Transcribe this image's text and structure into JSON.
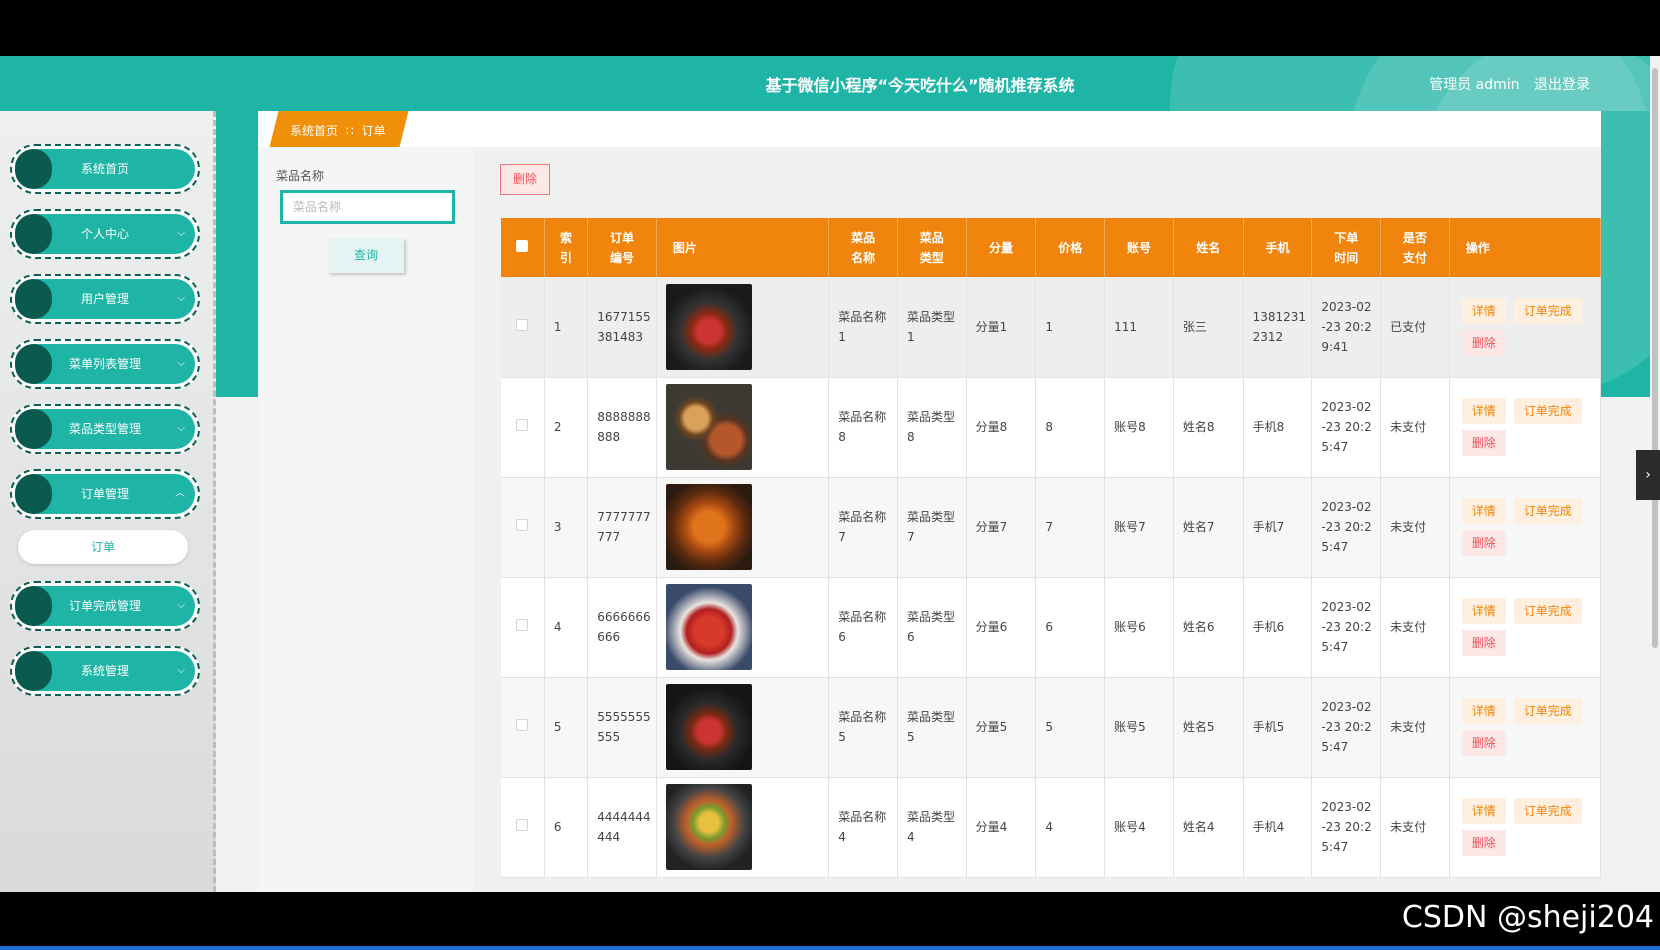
{
  "header": {
    "title": "基于微信小程序“今天吃什么”随机推荐系统",
    "user_label": "管理员 admin",
    "logout": "退出登录"
  },
  "sidebar": {
    "items": [
      {
        "label": "系统首页",
        "chevron": ""
      },
      {
        "label": "个人中心",
        "chevron": "⌵"
      },
      {
        "label": "用户管理",
        "chevron": "⌵"
      },
      {
        "label": "菜单列表管理",
        "chevron": "⌵"
      },
      {
        "label": "菜品类型管理",
        "chevron": "⌵"
      },
      {
        "label": "订单管理",
        "chevron": "︿"
      },
      {
        "label": "订单完成管理",
        "chevron": "⌵"
      },
      {
        "label": "系统管理",
        "chevron": "⌵"
      }
    ],
    "sub_item": "订单"
  },
  "breadcrumb": {
    "home": "系统首页",
    "sep": "∷",
    "current": "订单"
  },
  "filter": {
    "label": "菜品名称",
    "placeholder": "菜品名称",
    "query": "查询"
  },
  "toolbar": {
    "delete": "删除"
  },
  "table": {
    "headers": [
      "索引",
      "订单编号",
      "图片",
      "菜品名称",
      "菜品类型",
      "分量",
      "价格",
      "账号",
      "姓名",
      "手机",
      "下单时间",
      "是否支付",
      "操作"
    ],
    "headers_lines": [
      [
        "索",
        "引"
      ],
      [
        "订单",
        "编号"
      ],
      [
        "图片"
      ],
      [
        "菜品",
        "名称"
      ],
      [
        "菜品",
        "类型"
      ],
      [
        "分量"
      ],
      [
        "价格"
      ],
      [
        "账号"
      ],
      [
        "姓名"
      ],
      [
        "手机"
      ],
      [
        "下单",
        "时间"
      ],
      [
        "是否",
        "支付"
      ],
      [
        "操作"
      ]
    ],
    "rows": [
      {
        "idx": "1",
        "order_no": [
          "1677155",
          "381483"
        ],
        "dish": [
          "菜品名称",
          "1"
        ],
        "type": [
          "菜品类型",
          "1"
        ],
        "portion": "分量1",
        "price": "1",
        "account": "111",
        "name": "张三",
        "phone": [
          "1381231",
          "2312"
        ],
        "time": [
          "2023-02",
          "-23 20:2",
          "9:41"
        ],
        "paid": "已支付"
      },
      {
        "idx": "2",
        "order_no": [
          "8888888",
          "888"
        ],
        "dish": [
          "菜品名称",
          "8"
        ],
        "type": [
          "菜品类型",
          "8"
        ],
        "portion": "分量8",
        "price": "8",
        "account": "账号8",
        "name": "姓名8",
        "phone": [
          "手机8"
        ],
        "time": [
          "2023-02",
          "-23 20:2",
          "5:47"
        ],
        "paid": "未支付"
      },
      {
        "idx": "3",
        "order_no": [
          "7777777",
          "777"
        ],
        "dish": [
          "菜品名称",
          "7"
        ],
        "type": [
          "菜品类型",
          "7"
        ],
        "portion": "分量7",
        "price": "7",
        "account": "账号7",
        "name": "姓名7",
        "phone": [
          "手机7"
        ],
        "time": [
          "2023-02",
          "-23 20:2",
          "5:47"
        ],
        "paid": "未支付"
      },
      {
        "idx": "4",
        "order_no": [
          "6666666",
          "666"
        ],
        "dish": [
          "菜品名称",
          "6"
        ],
        "type": [
          "菜品类型",
          "6"
        ],
        "portion": "分量6",
        "price": "6",
        "account": "账号6",
        "name": "姓名6",
        "phone": [
          "手机6"
        ],
        "time": [
          "2023-02",
          "-23 20:2",
          "5:47"
        ],
        "paid": "未支付"
      },
      {
        "idx": "5",
        "order_no": [
          "5555555",
          "555"
        ],
        "dish": [
          "菜品名称",
          "5"
        ],
        "type": [
          "菜品类型",
          "5"
        ],
        "portion": "分量5",
        "price": "5",
        "account": "账号5",
        "name": "姓名5",
        "phone": [
          "手机5"
        ],
        "time": [
          "2023-02",
          "-23 20:2",
          "5:47"
        ],
        "paid": "未支付"
      },
      {
        "idx": "6",
        "order_no": [
          "4444444",
          "444"
        ],
        "dish": [
          "菜品名称",
          "4"
        ],
        "type": [
          "菜品类型",
          "4"
        ],
        "portion": "分量4",
        "price": "4",
        "account": "账号4",
        "name": "姓名4",
        "phone": [
          "手机4"
        ],
        "time": [
          "2023-02",
          "-23 20:2",
          "5:47"
        ],
        "paid": "未支付"
      }
    ],
    "actions": {
      "detail": "详情",
      "done": "订单完成",
      "delete": "删除"
    }
  },
  "watermark": "CSDN @sheji204",
  "colors": {
    "teal": "#1fb5a6",
    "orange": "#f0840c",
    "dark_teal": "#0b5a4f"
  }
}
